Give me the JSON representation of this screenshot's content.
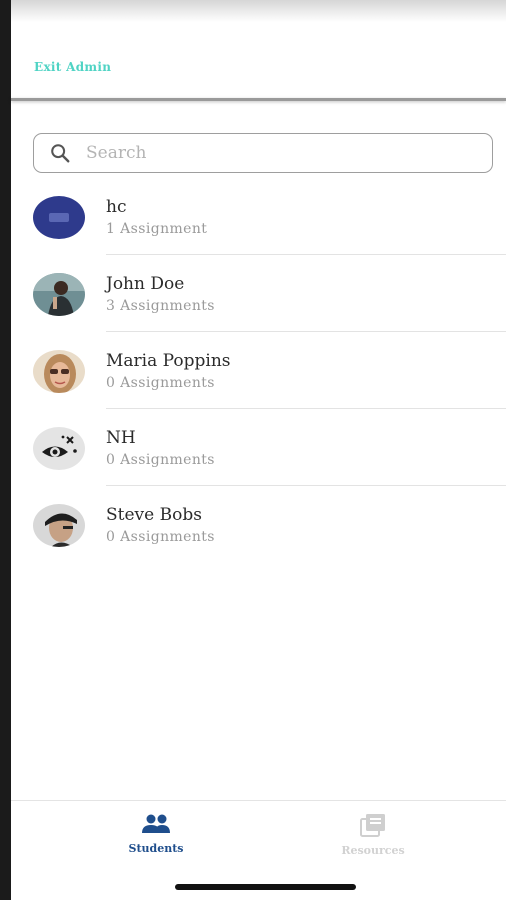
{
  "header": {
    "exit_admin_label": "Exit Admin"
  },
  "search": {
    "placeholder": "Search",
    "value": ""
  },
  "students": [
    {
      "name": "hc",
      "assignments": "1 Assignment",
      "avatar_icon": "hc-logo-avatar"
    },
    {
      "name": "John Doe",
      "assignments": "3 Assignments",
      "avatar_icon": "man-photo-avatar"
    },
    {
      "name": "Maria Poppins",
      "assignments": "0 Assignments",
      "avatar_icon": "woman-sunglasses-photo-avatar"
    },
    {
      "name": "NH",
      "assignments": "0 Assignments",
      "avatar_icon": "eye-doodle-avatar"
    },
    {
      "name": "Steve Bobs",
      "assignments": "0 Assignments",
      "avatar_icon": "man-cap-photo-avatar"
    }
  ],
  "tabbar": {
    "students_label": "Students",
    "resources_label": "Resources",
    "active": "Students"
  },
  "colors": {
    "accent_teal": "#4fd3c4",
    "active_tab": "#1f4e8c",
    "inactive_tab": "#d2d2d2"
  }
}
